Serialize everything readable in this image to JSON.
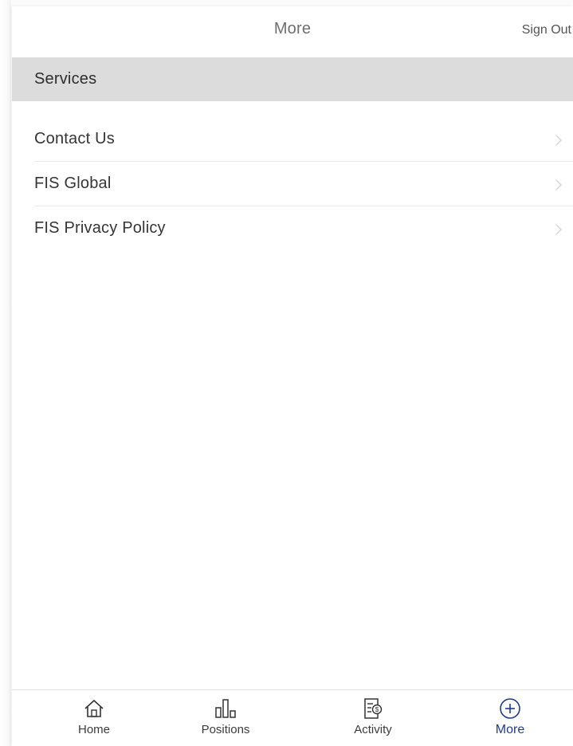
{
  "header": {
    "title": "More",
    "sign_out_label": "Sign Out"
  },
  "services": {
    "section_title": "Services",
    "items": [
      {
        "label": "Contact Us",
        "icon": "chevron-right-icon"
      },
      {
        "label": "FIS Global",
        "icon": "chevron-right-icon"
      },
      {
        "label": "FIS Privacy Policy",
        "icon": "chevron-right-icon"
      }
    ]
  },
  "tabbar": {
    "items": [
      {
        "label": "Home",
        "icon": "home-icon",
        "active": false
      },
      {
        "label": "Positions",
        "icon": "bar-chart-icon",
        "active": false
      },
      {
        "label": "Activity",
        "icon": "activity-document-icon",
        "active": false
      },
      {
        "label": "More",
        "icon": "plus-circle-icon",
        "active": true
      }
    ]
  },
  "colors": {
    "section_header_bg": "#dcdcdc",
    "active_tab": "#1f3b8c",
    "text": "#353535"
  }
}
